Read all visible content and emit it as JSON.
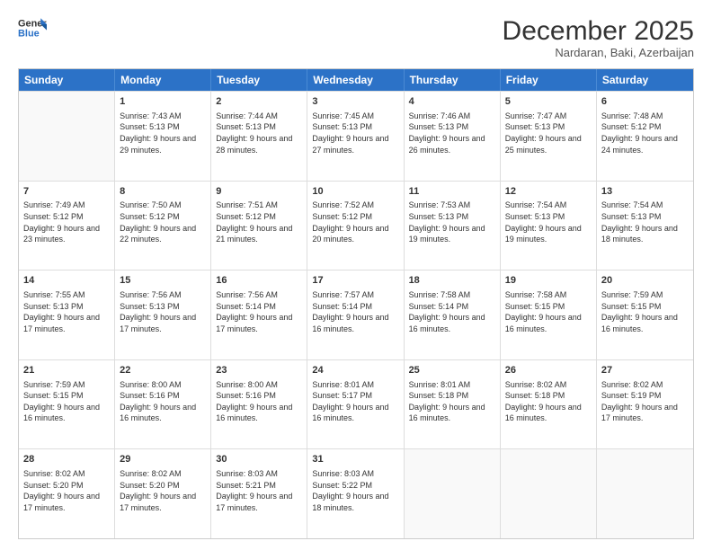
{
  "logo": {
    "line1": "General",
    "line2": "Blue"
  },
  "title": "December 2025",
  "location": "Nardaran, Baki, Azerbaijan",
  "days_header": [
    "Sunday",
    "Monday",
    "Tuesday",
    "Wednesday",
    "Thursday",
    "Friday",
    "Saturday"
  ],
  "weeks": [
    [
      {
        "day": "",
        "empty": true
      },
      {
        "day": "1",
        "sunrise": "7:43 AM",
        "sunset": "5:13 PM",
        "daylight": "9 hours and 29 minutes."
      },
      {
        "day": "2",
        "sunrise": "7:44 AM",
        "sunset": "5:13 PM",
        "daylight": "9 hours and 28 minutes."
      },
      {
        "day": "3",
        "sunrise": "7:45 AM",
        "sunset": "5:13 PM",
        "daylight": "9 hours and 27 minutes."
      },
      {
        "day": "4",
        "sunrise": "7:46 AM",
        "sunset": "5:13 PM",
        "daylight": "9 hours and 26 minutes."
      },
      {
        "day": "5",
        "sunrise": "7:47 AM",
        "sunset": "5:13 PM",
        "daylight": "9 hours and 25 minutes."
      },
      {
        "day": "6",
        "sunrise": "7:48 AM",
        "sunset": "5:12 PM",
        "daylight": "9 hours and 24 minutes."
      }
    ],
    [
      {
        "day": "7",
        "sunrise": "7:49 AM",
        "sunset": "5:12 PM",
        "daylight": "9 hours and 23 minutes."
      },
      {
        "day": "8",
        "sunrise": "7:50 AM",
        "sunset": "5:12 PM",
        "daylight": "9 hours and 22 minutes."
      },
      {
        "day": "9",
        "sunrise": "7:51 AM",
        "sunset": "5:12 PM",
        "daylight": "9 hours and 21 minutes."
      },
      {
        "day": "10",
        "sunrise": "7:52 AM",
        "sunset": "5:12 PM",
        "daylight": "9 hours and 20 minutes."
      },
      {
        "day": "11",
        "sunrise": "7:53 AM",
        "sunset": "5:13 PM",
        "daylight": "9 hours and 19 minutes."
      },
      {
        "day": "12",
        "sunrise": "7:54 AM",
        "sunset": "5:13 PM",
        "daylight": "9 hours and 19 minutes."
      },
      {
        "day": "13",
        "sunrise": "7:54 AM",
        "sunset": "5:13 PM",
        "daylight": "9 hours and 18 minutes."
      }
    ],
    [
      {
        "day": "14",
        "sunrise": "7:55 AM",
        "sunset": "5:13 PM",
        "daylight": "9 hours and 17 minutes."
      },
      {
        "day": "15",
        "sunrise": "7:56 AM",
        "sunset": "5:13 PM",
        "daylight": "9 hours and 17 minutes."
      },
      {
        "day": "16",
        "sunrise": "7:56 AM",
        "sunset": "5:14 PM",
        "daylight": "9 hours and 17 minutes."
      },
      {
        "day": "17",
        "sunrise": "7:57 AM",
        "sunset": "5:14 PM",
        "daylight": "9 hours and 16 minutes."
      },
      {
        "day": "18",
        "sunrise": "7:58 AM",
        "sunset": "5:14 PM",
        "daylight": "9 hours and 16 minutes."
      },
      {
        "day": "19",
        "sunrise": "7:58 AM",
        "sunset": "5:15 PM",
        "daylight": "9 hours and 16 minutes."
      },
      {
        "day": "20",
        "sunrise": "7:59 AM",
        "sunset": "5:15 PM",
        "daylight": "9 hours and 16 minutes."
      }
    ],
    [
      {
        "day": "21",
        "sunrise": "7:59 AM",
        "sunset": "5:15 PM",
        "daylight": "9 hours and 16 minutes."
      },
      {
        "day": "22",
        "sunrise": "8:00 AM",
        "sunset": "5:16 PM",
        "daylight": "9 hours and 16 minutes."
      },
      {
        "day": "23",
        "sunrise": "8:00 AM",
        "sunset": "5:16 PM",
        "daylight": "9 hours and 16 minutes."
      },
      {
        "day": "24",
        "sunrise": "8:01 AM",
        "sunset": "5:17 PM",
        "daylight": "9 hours and 16 minutes."
      },
      {
        "day": "25",
        "sunrise": "8:01 AM",
        "sunset": "5:18 PM",
        "daylight": "9 hours and 16 minutes."
      },
      {
        "day": "26",
        "sunrise": "8:02 AM",
        "sunset": "5:18 PM",
        "daylight": "9 hours and 16 minutes."
      },
      {
        "day": "27",
        "sunrise": "8:02 AM",
        "sunset": "5:19 PM",
        "daylight": "9 hours and 17 minutes."
      }
    ],
    [
      {
        "day": "28",
        "sunrise": "8:02 AM",
        "sunset": "5:20 PM",
        "daylight": "9 hours and 17 minutes."
      },
      {
        "day": "29",
        "sunrise": "8:02 AM",
        "sunset": "5:20 PM",
        "daylight": "9 hours and 17 minutes."
      },
      {
        "day": "30",
        "sunrise": "8:03 AM",
        "sunset": "5:21 PM",
        "daylight": "9 hours and 17 minutes."
      },
      {
        "day": "31",
        "sunrise": "8:03 AM",
        "sunset": "5:22 PM",
        "daylight": "9 hours and 18 minutes."
      },
      {
        "day": "",
        "empty": true
      },
      {
        "day": "",
        "empty": true
      },
      {
        "day": "",
        "empty": true
      }
    ]
  ],
  "labels": {
    "sunrise": "Sunrise:",
    "sunset": "Sunset:",
    "daylight": "Daylight:"
  }
}
